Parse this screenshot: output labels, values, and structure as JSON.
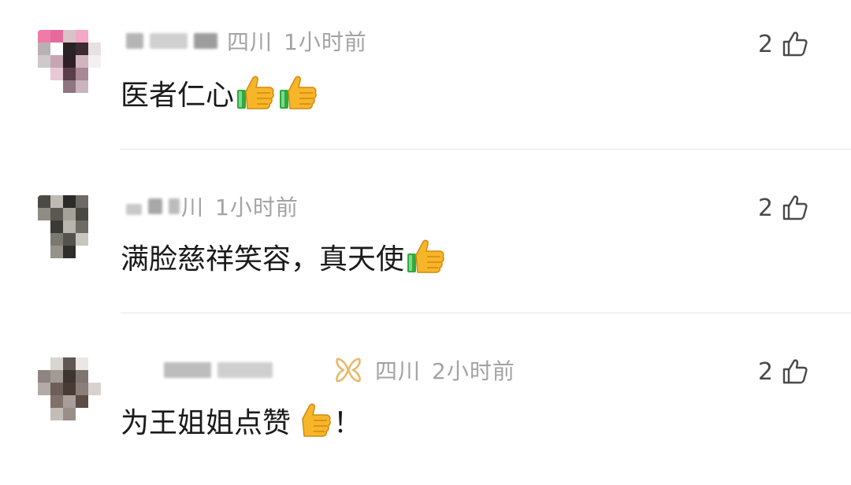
{
  "comments": [
    {
      "region": "四川",
      "time": "1小时前",
      "text": "医者仁心",
      "emoji_count": 2,
      "likes": "2",
      "avatar_colors": [
        "#f07aa8",
        "#e66a9e",
        "#d9c3c8",
        "#f3a8c6",
        "#ffffff",
        "#b8b0b3",
        "#ffffff",
        "#2a2225",
        "#3a2c31",
        "#e9e0e2",
        "#cfc9cb",
        "#c7a6b3",
        "#301e26",
        "#d2b4bf",
        "#f2f0f1",
        "#ffffff",
        "#e8c8d4",
        "#5a3e49",
        "#a88895",
        "#ffffff",
        "#ffffff",
        "#ffffff",
        "#8d7680",
        "#c9b3bc",
        "#ffffff"
      ]
    },
    {
      "region": "川",
      "time": "1小时前",
      "text": "满脸慈祥笑容，真天使",
      "emoji_count": 1,
      "likes": "2",
      "avatar_colors": [
        "#4c4a45",
        "#bdbbb4",
        "#2d2b28",
        "#6d6a63",
        "#ffffff",
        "#8f8c83",
        "#5a5851",
        "#a5a399",
        "#4a4843",
        "#ffffff",
        "#ffffff",
        "#3c3a36",
        "#b9b6ad",
        "#6e6b64",
        "#ffffff",
        "#ffffff",
        "#7b7870",
        "#54524c",
        "#c8c5bc",
        "#ffffff",
        "#ffffff",
        "#969389",
        "#2f2e2b",
        "#ffffff",
        "#ffffff"
      ]
    },
    {
      "region": "四川",
      "time": "2小时前",
      "text": "为王姐姐点赞",
      "text_suffix": "！",
      "emoji_count": 1,
      "likes": "2",
      "avatar_colors": [
        "#ffffff",
        "#d9d6d2",
        "#5f5753",
        "#eae7e4",
        "#ffffff",
        "#8f8580",
        "#a19a95",
        "#3e3531",
        "#7e7470",
        "#ffffff",
        "#b3aba6",
        "#6c5e58",
        "#4a3a34",
        "#8b7d77",
        "#d8d2ce",
        "#ffffff",
        "#7f706a",
        "#a89d98",
        "#5b4c46",
        "#ffffff",
        "#ffffff",
        "#c4bcb7",
        "#9a8e88",
        "#ffffff",
        "#ffffff"
      ]
    }
  ],
  "colors": {
    "meta": "#a3a3a3",
    "text": "#1a1a1a",
    "divider": "#e6e6e6",
    "thumb_yellow": "#f7b528",
    "thumb_green": "#2eaa3e",
    "badge_gold": "#e9b86b"
  },
  "icons": {
    "like": "thumbs-up-outline-icon",
    "emoji": "thumbs-up-emoji",
    "badge": "ribbon-badge-icon"
  }
}
